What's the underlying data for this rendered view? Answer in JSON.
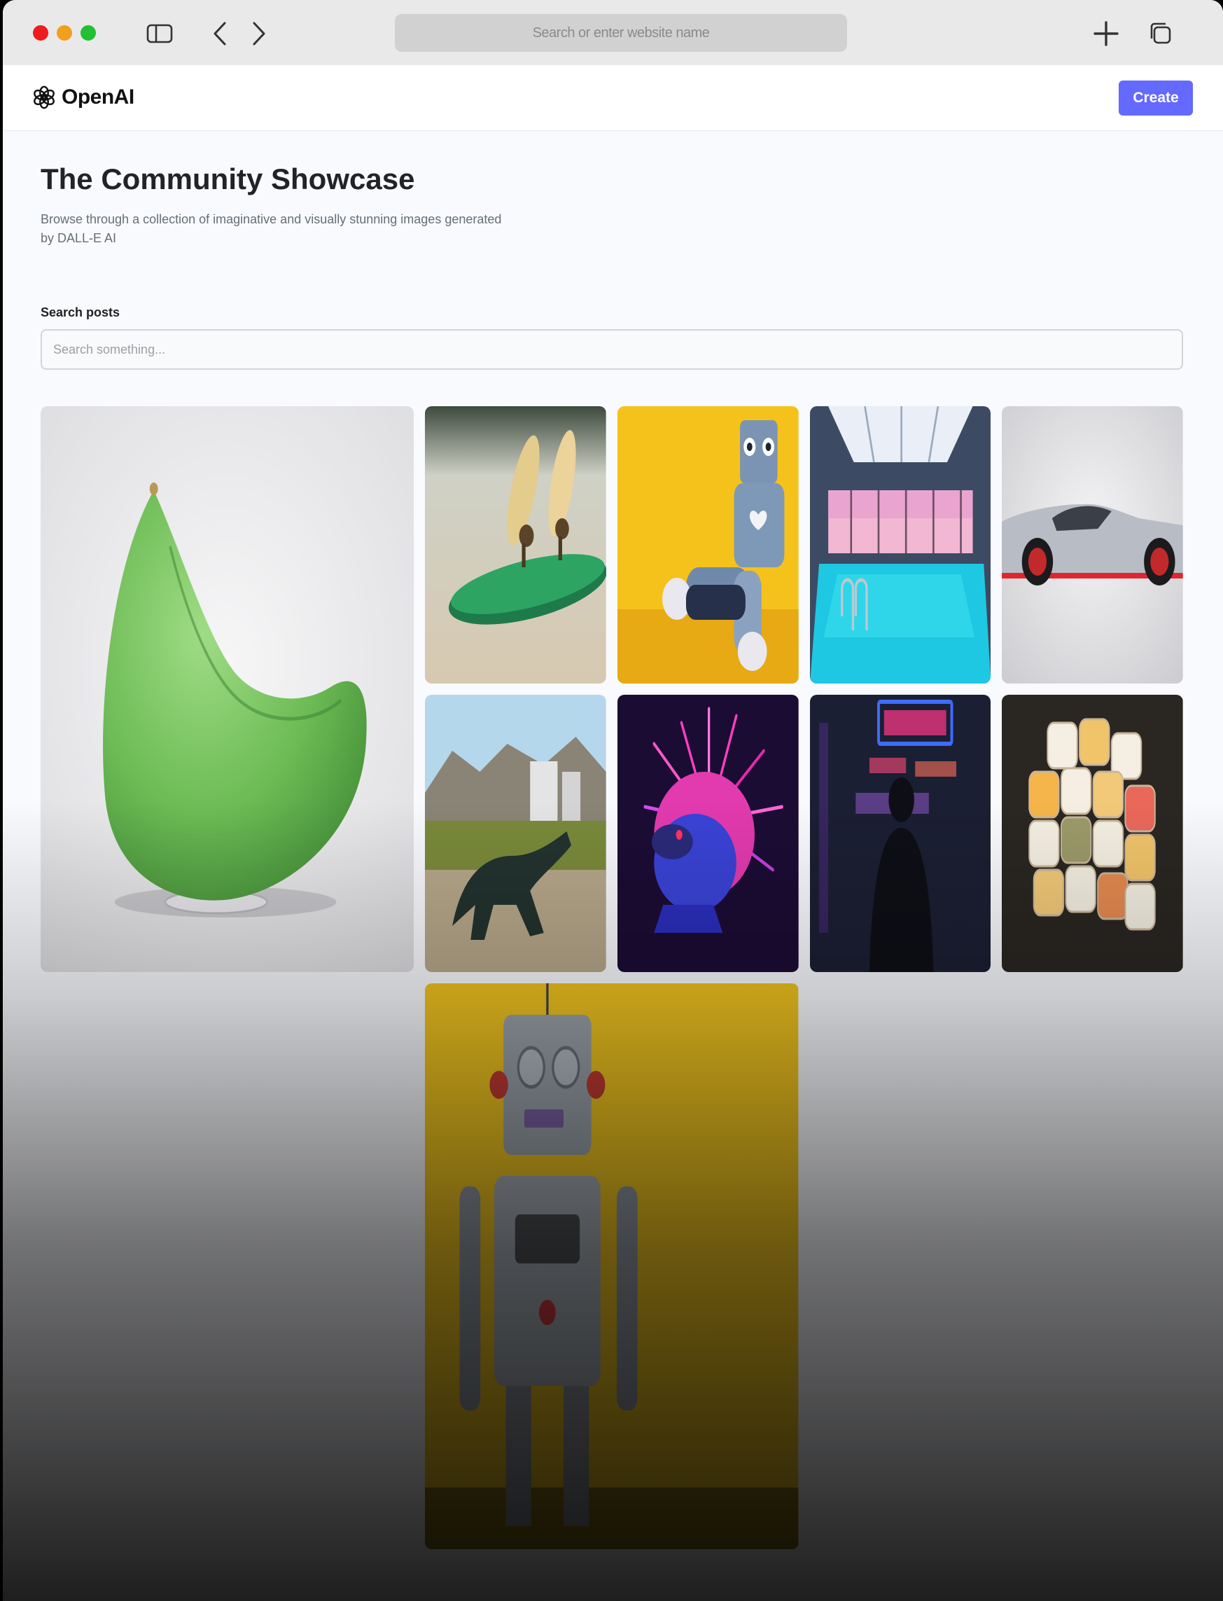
{
  "browser": {
    "address_placeholder": "Search or enter website name",
    "icons": [
      "sidebar-icon",
      "back-arrow-icon",
      "forward-arrow-icon",
      "new-tab-plus-icon",
      "tabs-overview-icon"
    ]
  },
  "header": {
    "logo_text": "OpenAI",
    "create_label": "Create",
    "accent_color": "#6469ff"
  },
  "main": {
    "title": "The Community Showcase",
    "subtitle": "Browse through a collection of imaginative and visually stunning images generated by DALL-E AI",
    "search_label": "Search posts",
    "search_placeholder": "Search something..."
  },
  "gallery": {
    "items": [
      "green-egg-chair",
      "surfboard-figurines",
      "knitted-robot",
      "indoor-pool",
      "silver-sports-car",
      "dinosaur-toy",
      "neon-hedgehog",
      "robot-yellow-wall",
      "neon-street",
      "food-cube"
    ]
  }
}
